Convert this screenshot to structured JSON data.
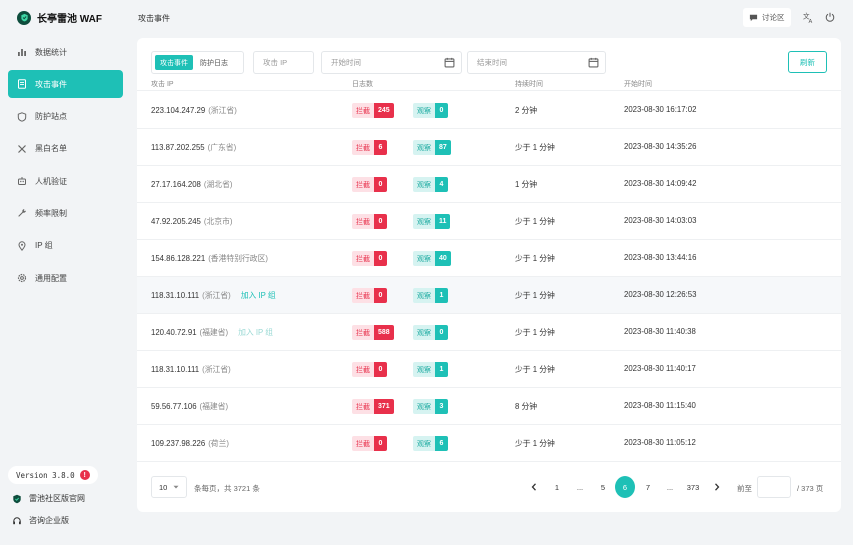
{
  "brand": {
    "title": "长亭雷池 WAF"
  },
  "sidebar": {
    "items": [
      {
        "label": "数据统计",
        "icon": "bar-chart-icon"
      },
      {
        "label": "攻击事件",
        "icon": "document-icon",
        "active": true
      },
      {
        "label": "防护站点",
        "icon": "shield-icon"
      },
      {
        "label": "黑白名单",
        "icon": "tools-icon"
      },
      {
        "label": "人机验证",
        "icon": "robot-icon"
      },
      {
        "label": "频率限制",
        "icon": "wrench-icon"
      },
      {
        "label": "IP 组",
        "icon": "location-icon"
      },
      {
        "label": "通用配置",
        "icon": "gear-icon"
      }
    ],
    "version": "Version 3.8.0",
    "version_badge": "!",
    "community_link": "雷池社区版官网",
    "enterprise_link": "咨询企业版"
  },
  "topbar": {
    "title": "攻击事件",
    "forum": "讨论区"
  },
  "filters": {
    "tab_events": "攻击事件",
    "tab_logs": "防护日志",
    "ip_placeholder": "攻击 IP",
    "start_placeholder": "开始时间",
    "end_placeholder": "结束时间",
    "refresh": "刷新"
  },
  "table": {
    "headers": {
      "ip": "攻击 IP",
      "count": "日志数",
      "duration": "持续时间",
      "start": "开始时间"
    },
    "block_label": "拦截",
    "watch_label": "观察",
    "rows": [
      {
        "ip": "223.104.247.29",
        "loc": "(浙江省)",
        "block": "245",
        "watch": "0",
        "duration": "2 分钟",
        "start": "2023-08-30 16:17:02"
      },
      {
        "ip": "113.87.202.255",
        "loc": "(广东省)",
        "block": "6",
        "watch": "87",
        "duration": "少于 1 分钟",
        "start": "2023-08-30 14:35:26"
      },
      {
        "ip": "27.17.164.208",
        "loc": "(湖北省)",
        "block": "0",
        "watch": "4",
        "duration": "1 分钟",
        "start": "2023-08-30 14:09:42"
      },
      {
        "ip": "47.92.205.245",
        "loc": "(北京市)",
        "block": "0",
        "watch": "11",
        "duration": "少于 1 分钟",
        "start": "2023-08-30 14:03:03"
      },
      {
        "ip": "154.86.128.221",
        "loc": "(香港特别行政区)",
        "block": "0",
        "watch": "40",
        "duration": "少于 1 分钟",
        "start": "2023-08-30 13:44:16"
      },
      {
        "ip": "118.31.10.111",
        "loc": "(浙江省)",
        "block": "0",
        "watch": "1",
        "duration": "少于 1 分钟",
        "start": "2023-08-30 12:26:53",
        "add_ip": "加入 IP 组"
      },
      {
        "ip": "120.40.72.91",
        "loc": "(福建省)",
        "block": "588",
        "watch": "0",
        "duration": "少于 1 分钟",
        "start": "2023-08-30 11:40:38",
        "add_ip": "加入 IP 组"
      },
      {
        "ip": "118.31.10.111",
        "loc": "(浙江省)",
        "block": "0",
        "watch": "1",
        "duration": "少于 1 分钟",
        "start": "2023-08-30 11:40:17"
      },
      {
        "ip": "59.56.77.106",
        "loc": "(福建省)",
        "block": "371",
        "watch": "3",
        "duration": "8 分钟",
        "start": "2023-08-30 11:15:40"
      },
      {
        "ip": "109.237.98.226",
        "loc": "(荷兰)",
        "block": "0",
        "watch": "6",
        "duration": "少于 1 分钟",
        "start": "2023-08-30 11:05:12"
      }
    ]
  },
  "pager": {
    "size": "10",
    "info": "条每页，共 3721 条",
    "pages": [
      "1",
      "...",
      "5",
      "6",
      "7",
      "...",
      "373"
    ],
    "current": "6",
    "goto": "前至",
    "total_pages": "/ 373 页"
  },
  "colors": {
    "accent": "#1ec0b6",
    "block": "#e8304b"
  }
}
